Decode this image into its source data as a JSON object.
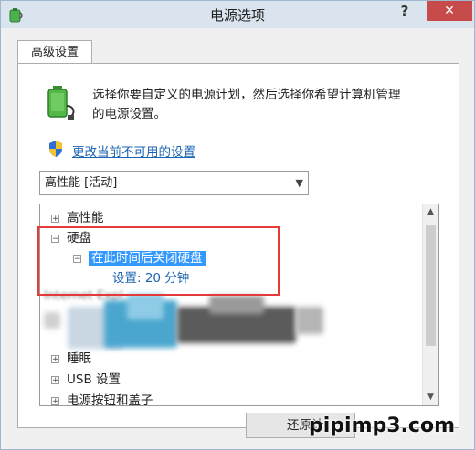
{
  "window": {
    "title": "电源选项",
    "help": "?",
    "close": "✕"
  },
  "tab": {
    "label": "高级设置"
  },
  "description": {
    "line1": "选择你要自定义的电源计划，然后选择你希望计算机管理",
    "line2": "的电源设置。"
  },
  "change_link": "更改当前不可用的设置",
  "plan_select": {
    "value": "高性能 [活动]"
  },
  "tree": {
    "items": [
      {
        "exp": "+",
        "label": "高性能"
      },
      {
        "exp": "−",
        "label": "硬盘"
      },
      {
        "exp": "−",
        "label": "在此时间后关闭硬盘"
      },
      {
        "label": "设置: 20 分钟"
      },
      {
        "label": "Internet Expl"
      },
      {
        "exp": "+",
        "label": "睡眠"
      },
      {
        "exp": "+",
        "label": "USB 设置"
      },
      {
        "exp": "+",
        "label": "电源按钮和盖子"
      }
    ]
  },
  "buttons": {
    "restore": "还原计"
  },
  "watermark": "pipimp3.com",
  "colors": {
    "accent": "#3399ff",
    "highlight_box": "#e53a3a",
    "link": "#1a64b3",
    "close": "#c74b4b"
  }
}
